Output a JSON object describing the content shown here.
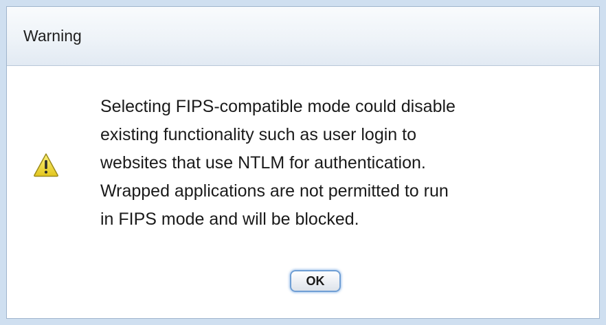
{
  "dialog": {
    "title": "Warning",
    "icon": "warning-triangle-icon",
    "message_lines": [
      "Selecting FIPS-compatible mode could disable",
      "existing functionality such as user login to",
      "websites that use NTLM for authentication.",
      "Wrapped applications are not permitted to run",
      "in FIPS mode and will be blocked."
    ],
    "ok_label": "OK"
  },
  "colors": {
    "icon_fill": "#f3e03a",
    "icon_border": "#9c8a1a",
    "button_focus": "#6f9ed4",
    "backdrop": "#cfdff0"
  }
}
